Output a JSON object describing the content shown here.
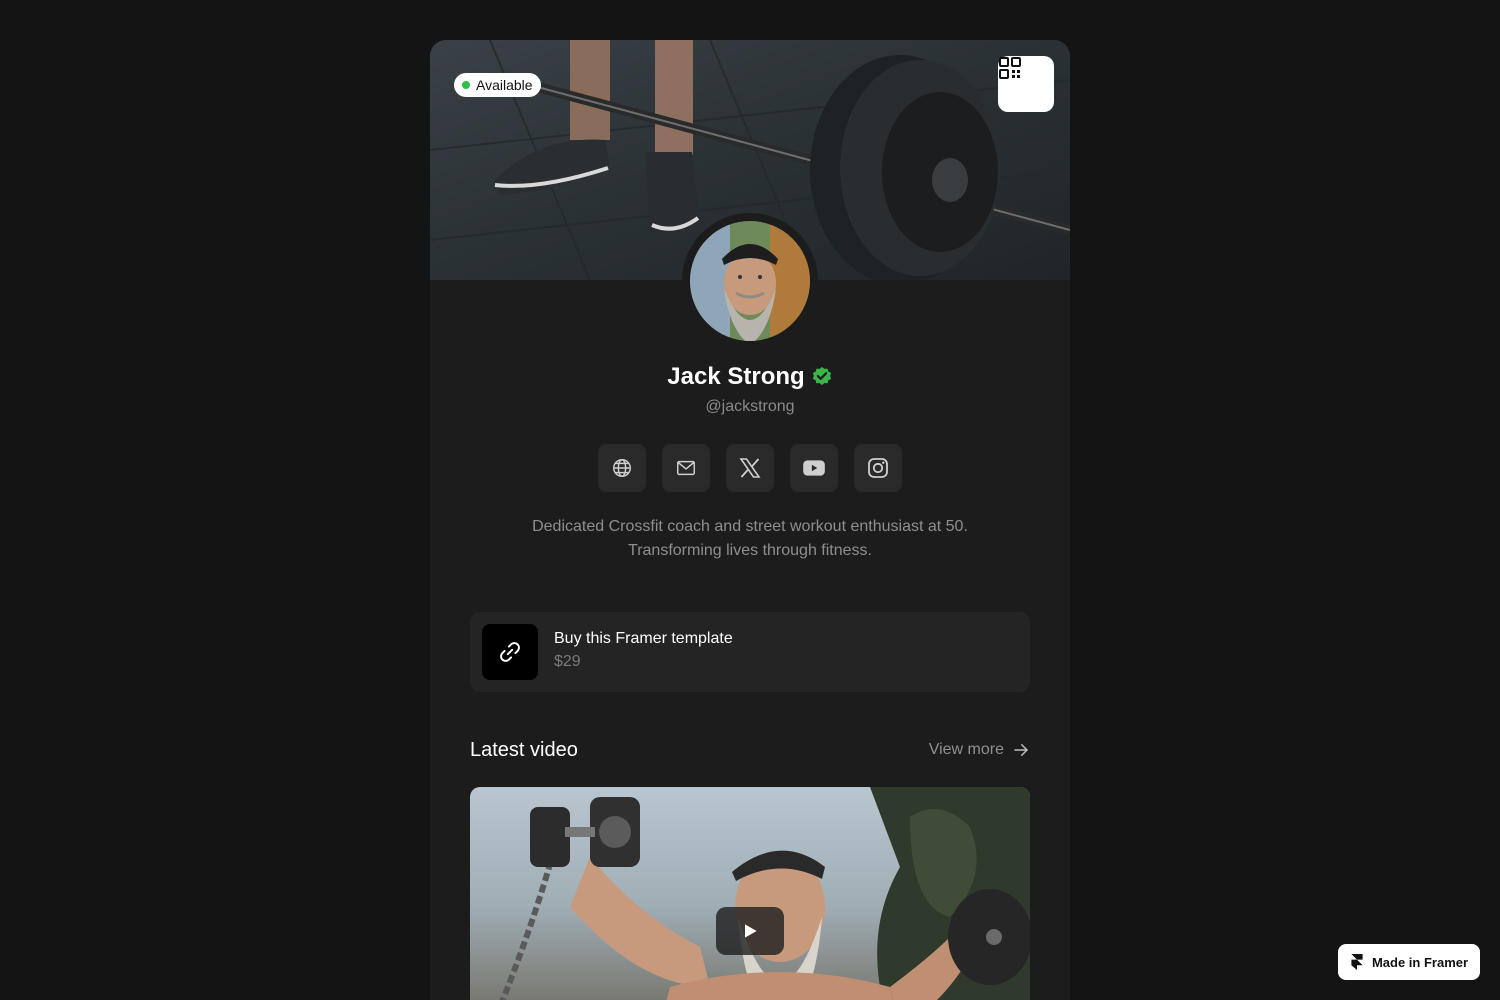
{
  "cover": {
    "status_badge": "Available",
    "status_color": "#2fbf4a"
  },
  "qr_button": {
    "icon": "qr-code-icon"
  },
  "profile": {
    "name": "Jack Strong",
    "verified_icon": "verified-badge-icon",
    "verified_color": "#3ab54a",
    "handle": "@jackstrong",
    "bio": "Dedicated Crossfit coach and street workout enthusiast at 50. Transforming lives through fitness."
  },
  "socials": [
    {
      "icon": "globe-icon"
    },
    {
      "icon": "mail-icon"
    },
    {
      "icon": "x-twitter-icon"
    },
    {
      "icon": "youtube-icon"
    },
    {
      "icon": "instagram-icon"
    }
  ],
  "link_card": {
    "icon": "link-icon",
    "title": "Buy this Framer template",
    "price": "$29"
  },
  "latest_video": {
    "title": "Latest video",
    "view_more": "View more",
    "play_icon": "play-icon"
  },
  "framer_badge": {
    "label": "Made in Framer",
    "icon": "framer-logo-icon"
  }
}
